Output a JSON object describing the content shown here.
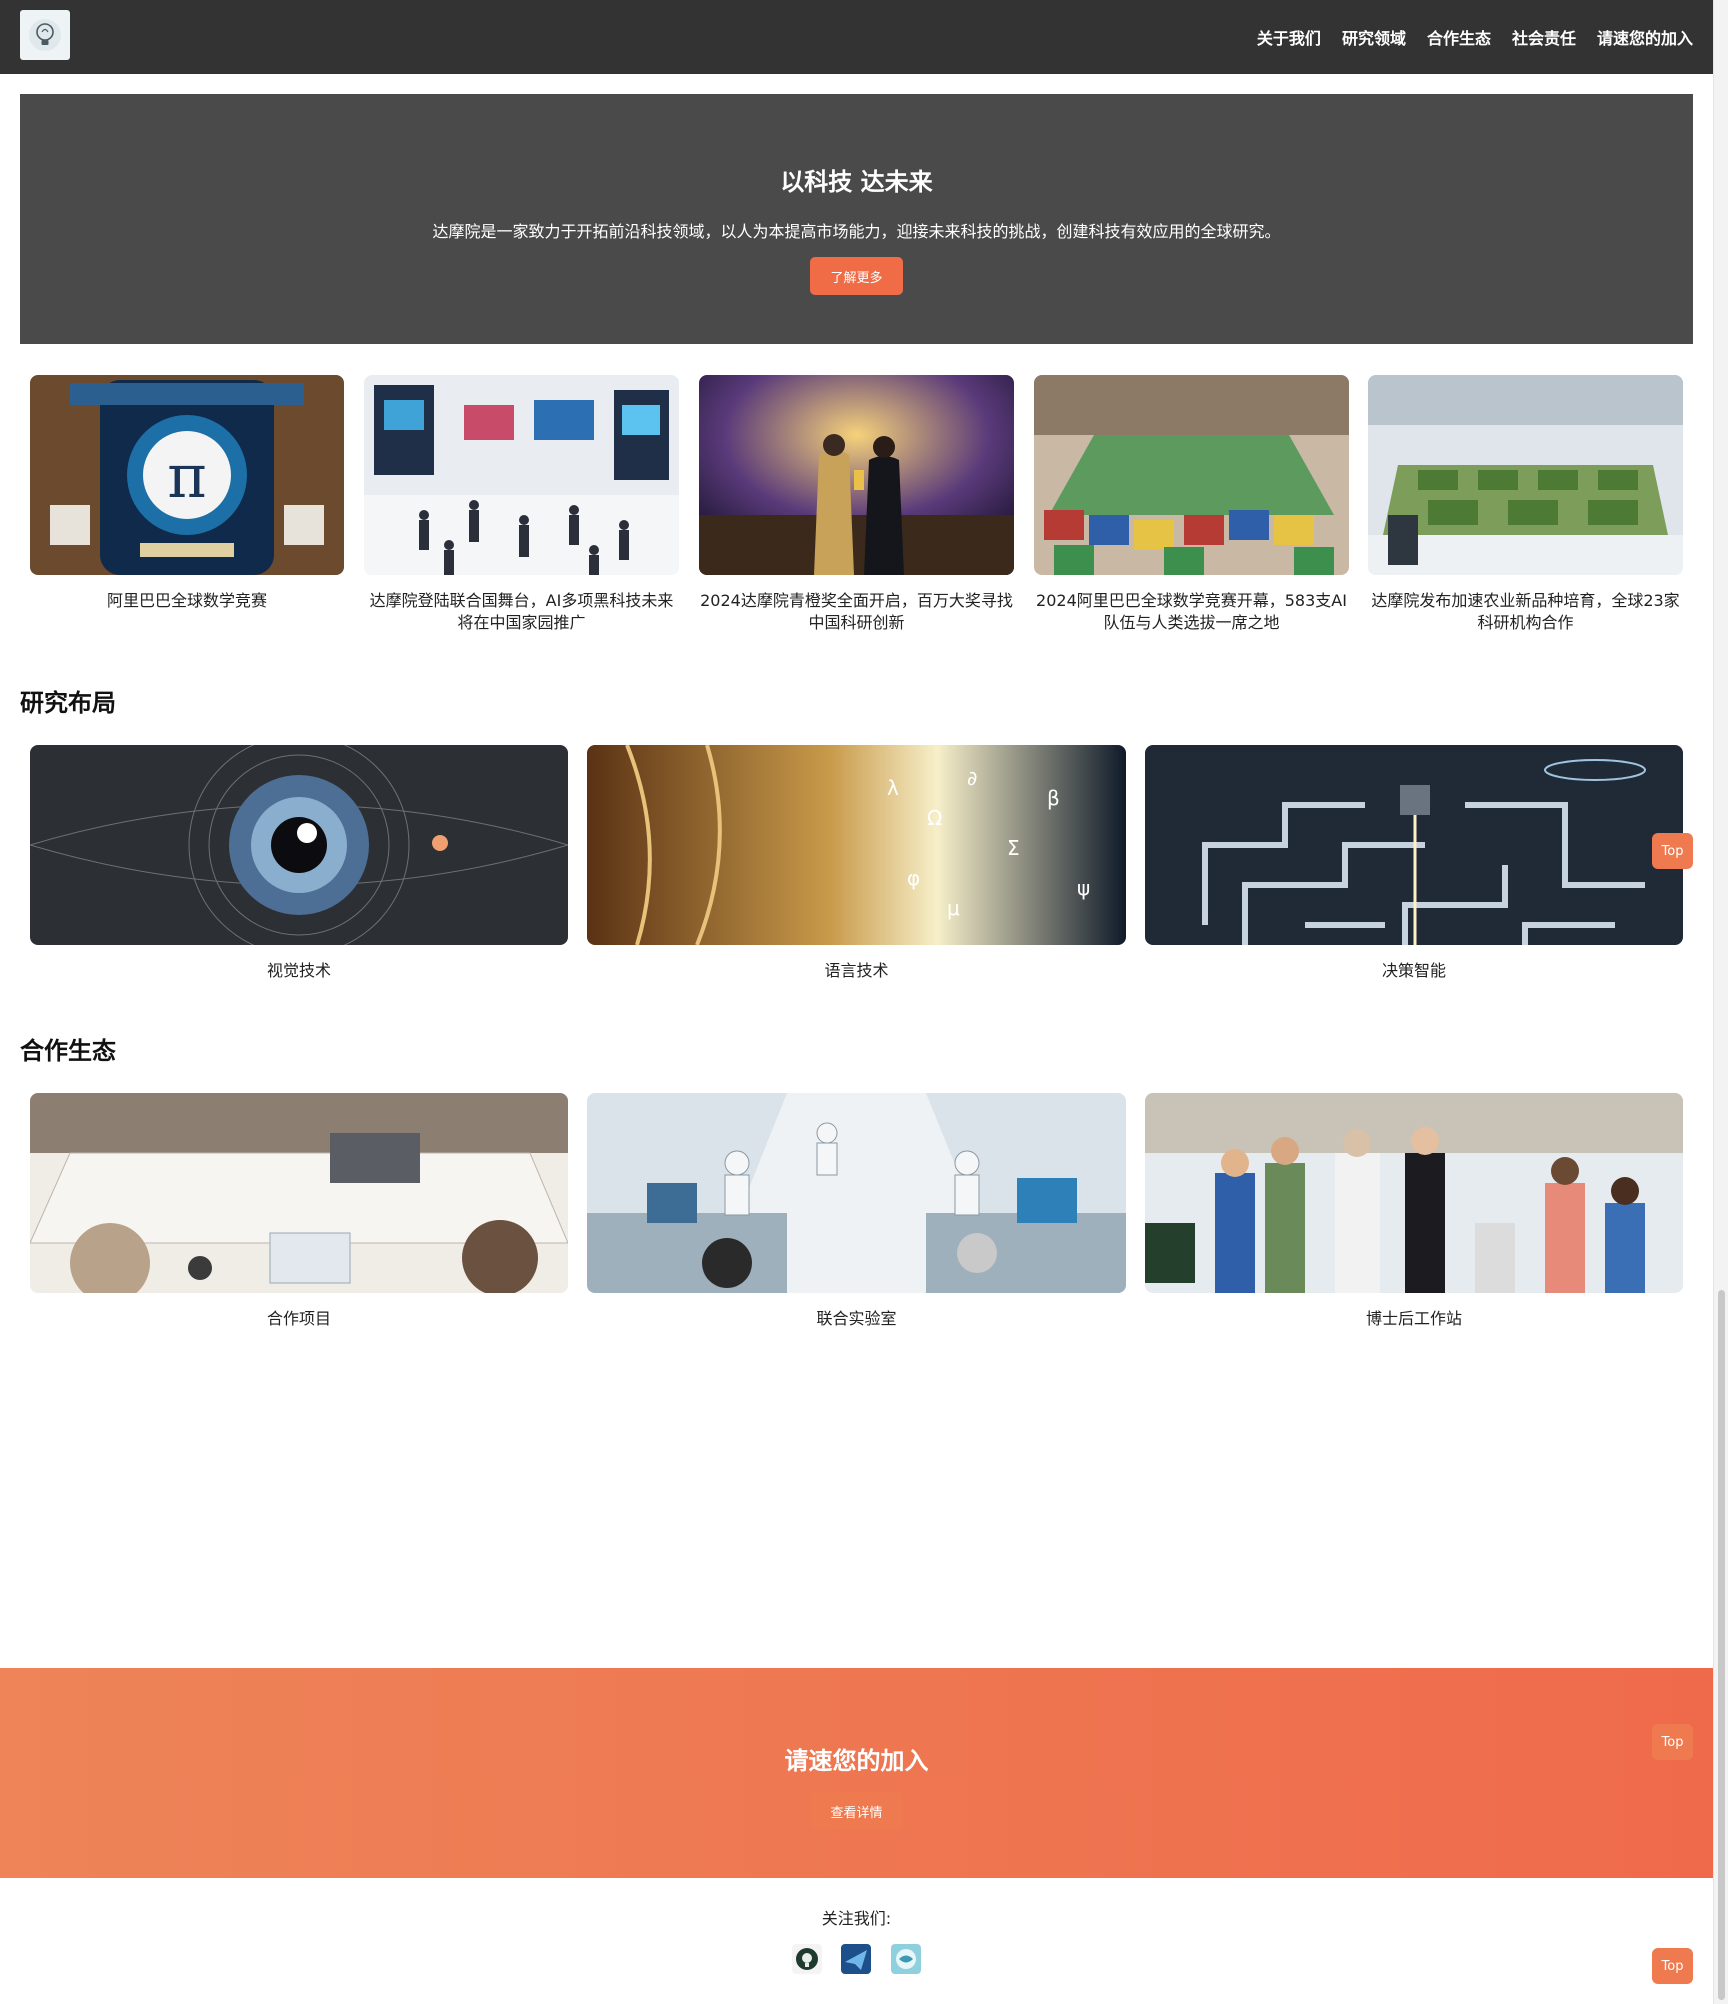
{
  "header": {
    "logo": "lightbulb-logo",
    "nav": [
      "关于我们",
      "研究领域",
      "合作生态",
      "社会责任",
      "请速您的加入"
    ]
  },
  "hero": {
    "title": "以科技 达未来",
    "description": "达摩院是一家致力于开拓前沿科技领域，以人为本提高市场能力，迎接未来科技的挑战，创建科技有效应用的全球研究。",
    "button": "了解更多"
  },
  "news": [
    {
      "title": "阿里巴巴全球数学竞赛",
      "image": "math-competition-pi-image"
    },
    {
      "title": "达摩院登陆联合国舞台，AI多项黑科技未来将在中国家园推广",
      "image": "tech-expo-crowd-image"
    },
    {
      "title": "2024达摩院青橙奖全面开启，百万大奖寻找中国科研创新",
      "image": "award-ceremony-image"
    },
    {
      "title": "2024阿里巴巴全球数学竞赛开幕，583支AI队伍与人类选拔一席之地",
      "image": "stadium-flags-image"
    },
    {
      "title": "达摩院发布加速农业新品种培育，全球23家科研机构合作",
      "image": "greenhouse-lab-image"
    }
  ],
  "research": {
    "title": "研究布局",
    "items": [
      {
        "label": "视觉技术",
        "image": "eye-vision-image"
      },
      {
        "label": "语言技术",
        "image": "language-characters-image"
      },
      {
        "label": "决策智能",
        "image": "maze-decision-image"
      }
    ]
  },
  "ecosystem": {
    "title": "合作生态",
    "items": [
      {
        "label": "合作项目",
        "image": "team-collaboration-image"
      },
      {
        "label": "联合实验室",
        "image": "laboratory-image"
      },
      {
        "label": "博士后工作站",
        "image": "scholars-crowd-image"
      }
    ]
  },
  "join": {
    "title": "请速您的加入",
    "button": "查看详情"
  },
  "footer": {
    "follow": "关注我们:",
    "icons": [
      "social-icon-1",
      "social-icon-2",
      "social-icon-3"
    ]
  },
  "top_button": "Top",
  "colors": {
    "header_bg": "#333333",
    "hero_bg": "#4a4a4a",
    "accent": "#ef6c47"
  }
}
